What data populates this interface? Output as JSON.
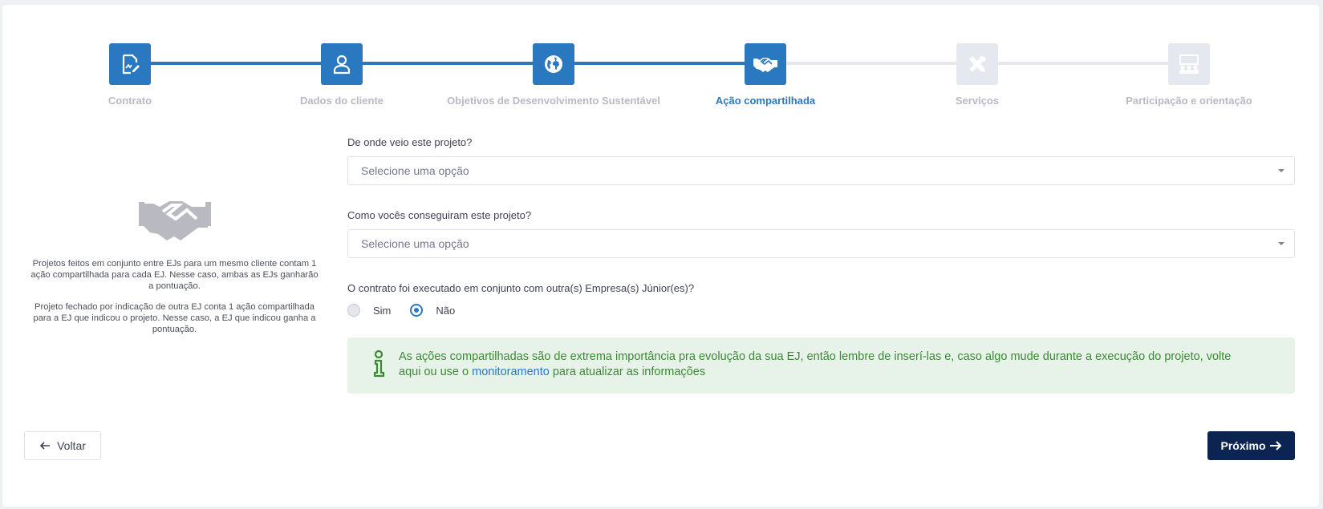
{
  "steps": [
    {
      "label": "Contrato",
      "icon": "contract-icon",
      "state": "done"
    },
    {
      "label": "Dados do cliente",
      "icon": "user-icon",
      "state": "done"
    },
    {
      "label": "Objetivos de Desenvolvimento Sustentável",
      "icon": "globe-icon",
      "state": "done"
    },
    {
      "label": "Ação compartilhada",
      "icon": "handshake-icon",
      "state": "current"
    },
    {
      "label": "Serviços",
      "icon": "tools-icon",
      "state": "todo"
    },
    {
      "label": "Participação e orientação",
      "icon": "people-icon",
      "state": "todo"
    }
  ],
  "info": {
    "icon": "handshake-icon",
    "paragraph1": "Projetos feitos em conjunto entre EJs para um mesmo cliente contam 1 ação compartilhada para cada EJ. Nesse caso, ambas as EJs ganharão a pontuação.",
    "paragraph2": "Projeto fechado por indicação de outra EJ conta 1 ação compartilhada para a EJ que indicou o projeto. Nesse caso, a EJ que indicou ganha a pontuação."
  },
  "form": {
    "origin": {
      "label": "De onde veio este projeto?",
      "placeholder": "Selecione uma opção"
    },
    "how": {
      "label": "Como vocês conseguiram este projeto?",
      "placeholder": "Selecione uma opção"
    },
    "joint": {
      "label": "O contrato foi executado em conjunto com outra(s) Empresa(s) Júnior(es)?",
      "options": [
        {
          "label": "Sim",
          "selected": false
        },
        {
          "label": "Não",
          "selected": true
        }
      ]
    }
  },
  "alert": {
    "icon": "info-icon",
    "text_before": "As ações compartilhadas são de extrema importância pra evolução da sua EJ, então lembre de inserí-las e, caso algo mude durante a execução do projeto, volte aqui ou use o",
    "link": "monitoramento",
    "text_after": "para atualizar as informações"
  },
  "buttons": {
    "back": "Voltar",
    "next": "Próximo"
  },
  "colors": {
    "primary": "#2a78c0",
    "inactive": "#e6e8ef",
    "navy": "#0c2452",
    "success_bg": "#e7f3e8",
    "success_text": "#3a8a33"
  }
}
